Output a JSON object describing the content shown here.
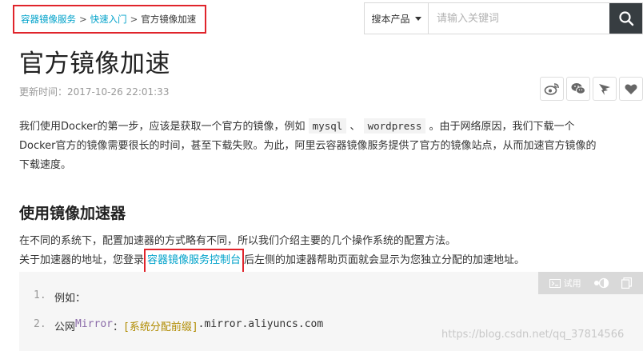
{
  "breadcrumb": {
    "items": [
      {
        "label": "容器镜像服务"
      },
      {
        "label": "快速入门"
      }
    ],
    "separator": ">",
    "current": "官方镜像加速"
  },
  "search": {
    "product_select": "搜本产品",
    "placeholder": "请输入关键词"
  },
  "article": {
    "title": "官方镜像加速",
    "updated": "更新时间：2017-10-26 22:01:33",
    "intro": {
      "p1a": "我们使用Docker的第一步，应该是获取一个官方的镜像，例如",
      "code1": "mysql",
      "sep": "、",
      "code2": "wordpress",
      "p1b": "。由于网络原因，我们下载一个",
      "line2": "Docker官方的镜像需要很长的时间，甚至下载失败。为此，阿里云容器镜像服务提供了官方的镜像站点，从而加速官方镜像的",
      "line3": "下载速度。"
    },
    "section_title": "使用镜像加速器",
    "section_p1": "在不同的系统下，配置加速器的方式略有不同，所以我们介绍主要的几个操作系统的配置方法。",
    "section_p2a": "关于加速器的地址，您登录",
    "section_link": "容器镜像服务控制台",
    "section_p2b": "后左侧的加速器帮助页面就会显示为您独立分配的加速地址。",
    "code": {
      "line1_no": "1.",
      "line1": "例如：",
      "line2_no": "2.",
      "line2_a": "公网",
      "line2_kw": "Mirror",
      "line2_b": "：",
      "line2_brk": "[系统分配前缀]",
      "line2_c": ".mirror.aliyuncs.com"
    },
    "try_label": "试用"
  },
  "watermark": "https://blog.csdn.net/qq_37814566",
  "colors": {
    "link": "#00a2ca",
    "highlight_border": "#e0242b",
    "search_button": "#373d41"
  }
}
